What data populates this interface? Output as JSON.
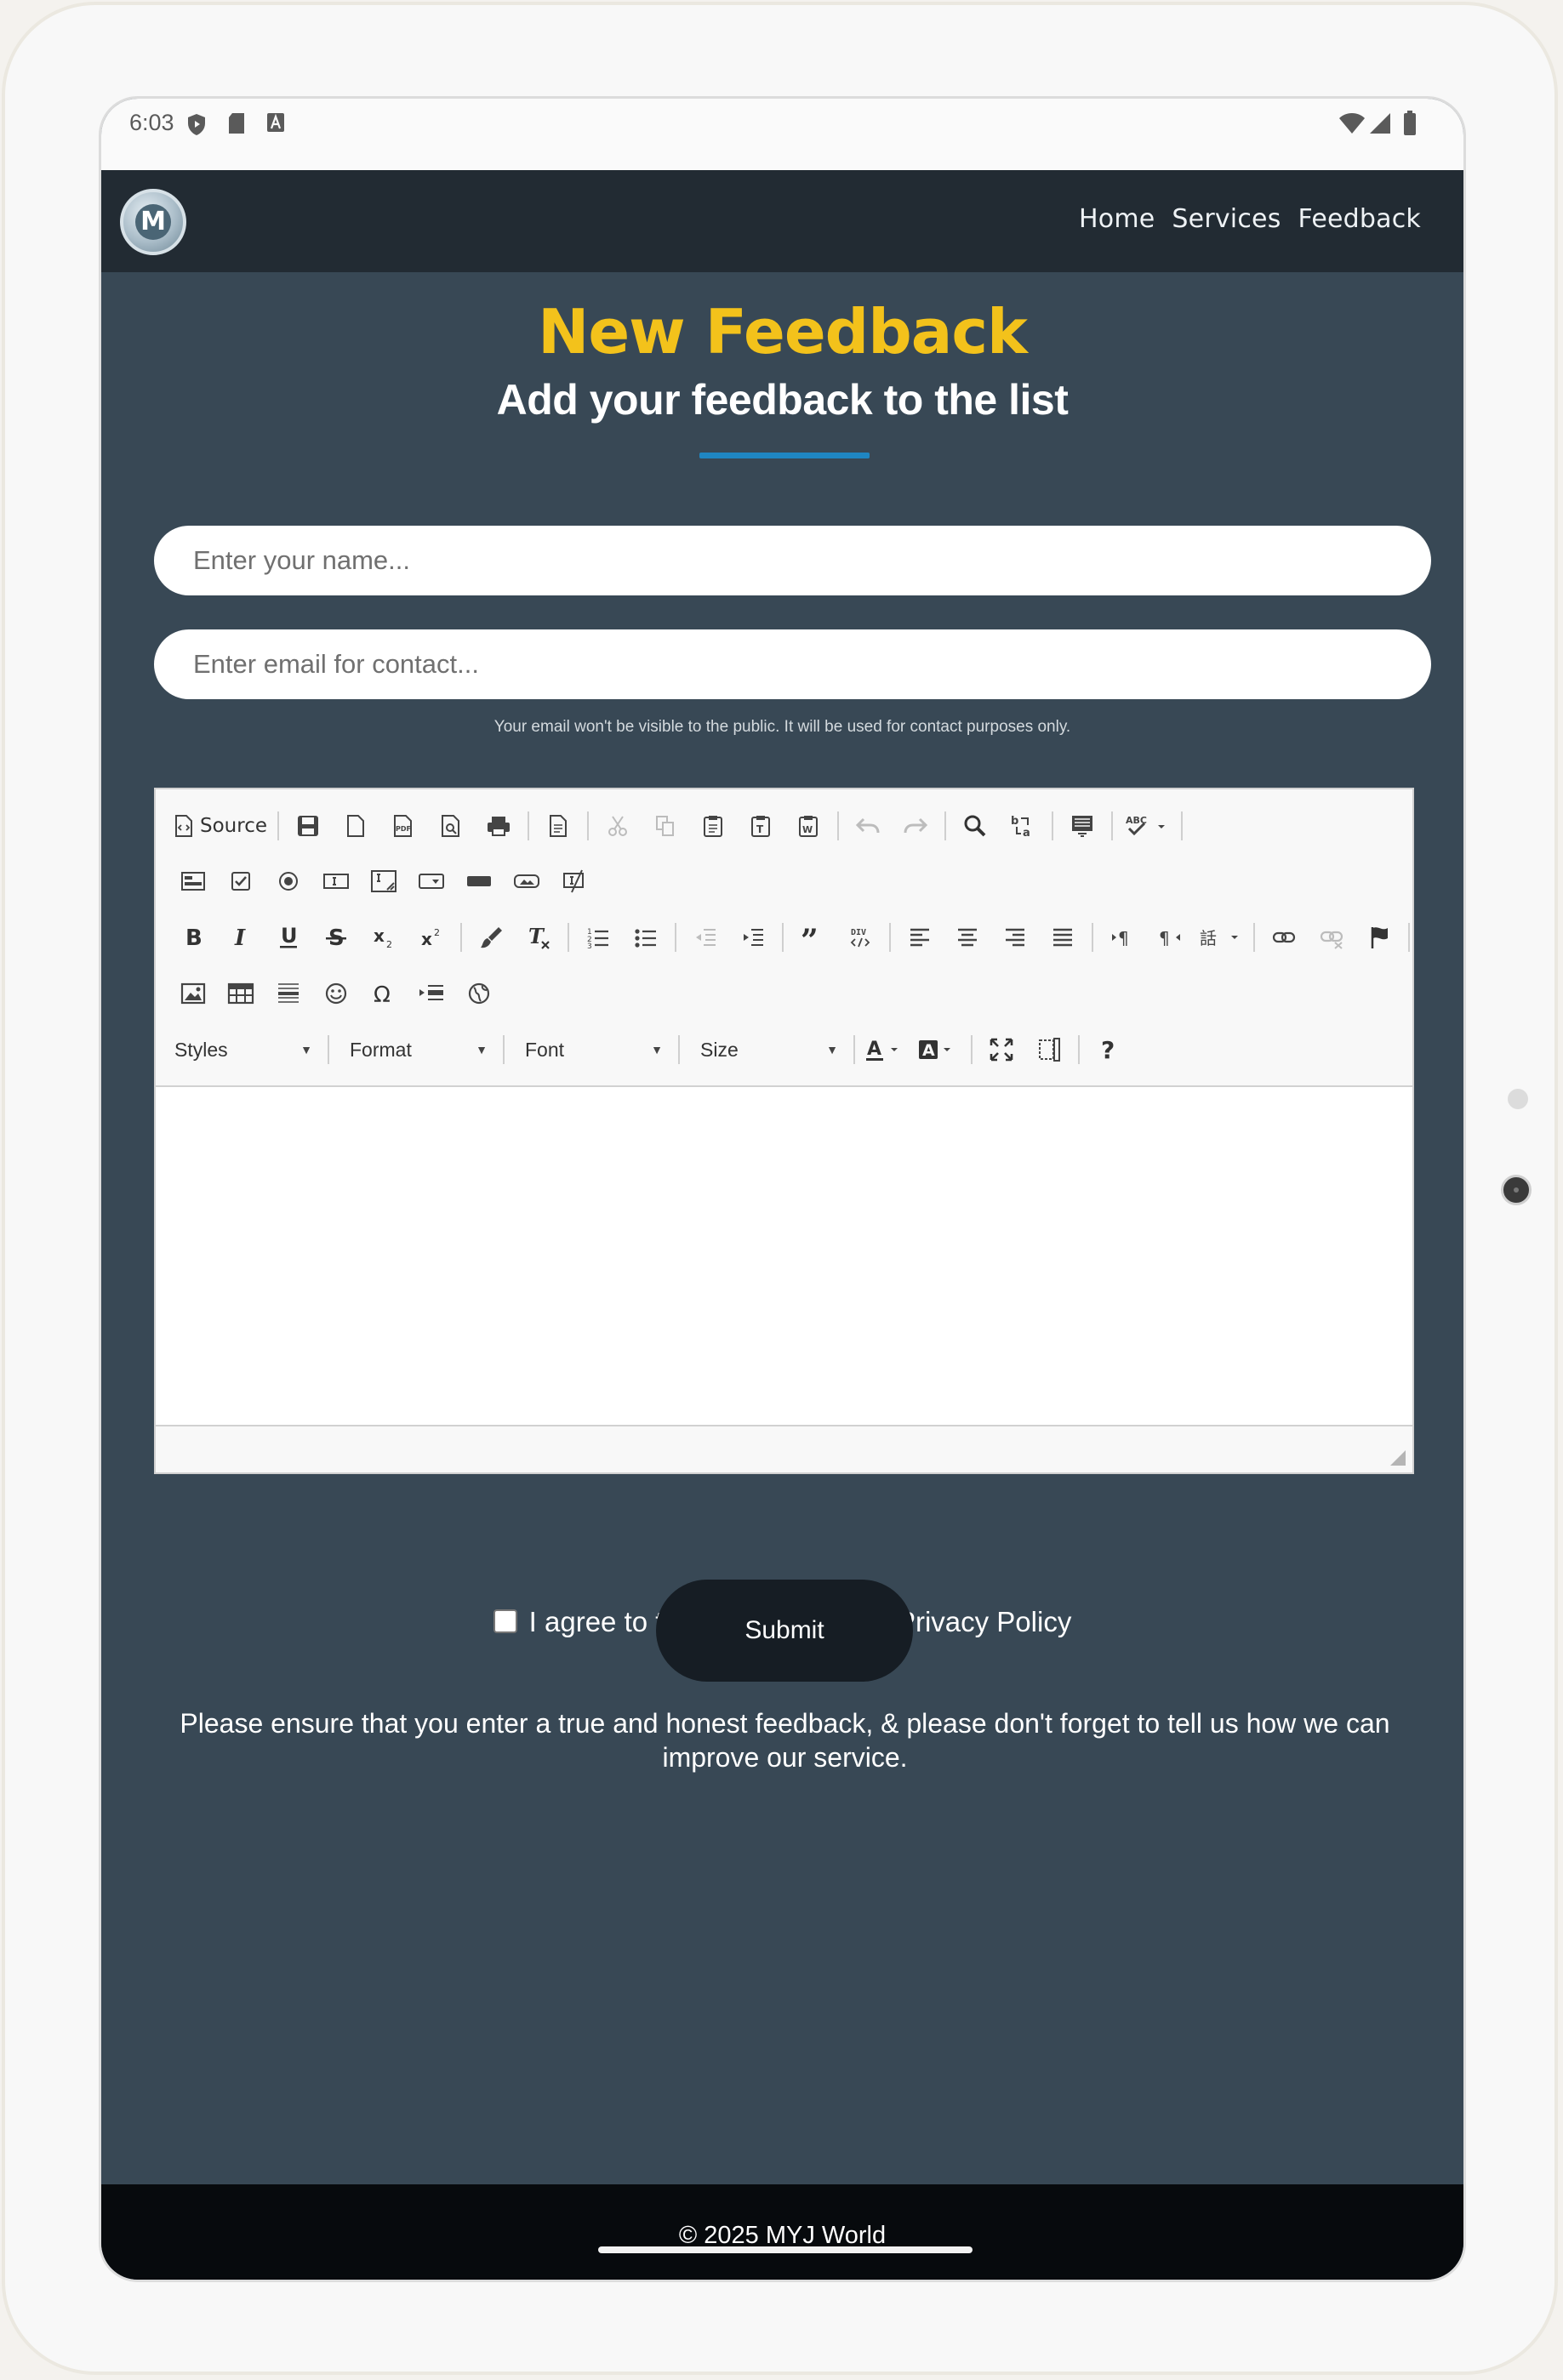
{
  "statusbar": {
    "time": "6:03",
    "icons": [
      "shield-icon",
      "sd-card-icon",
      "font-icon",
      "wifi-icon",
      "signal-icon",
      "battery-icon"
    ]
  },
  "navbar": {
    "logo_letter": "M",
    "links": [
      "Home",
      "Services",
      "Feedback"
    ]
  },
  "header": {
    "title": "New Feedback",
    "subtitle": "Add your feedback to the list"
  },
  "form": {
    "name_placeholder": "Enter your name...",
    "email_placeholder": "Enter email for contact...",
    "email_note": "Your email won't be visible to the public. It will be used for contact purposes only.",
    "agree_label": "I agree to the Terms of use & Privacy Policy",
    "submit_label": "Submit",
    "bottom_note": "Please ensure that you enter a true and honest feedback, & please don't forget to tell us how we can improve our service."
  },
  "editor": {
    "source_label": "Source",
    "combos": [
      "Styles",
      "Format",
      "Font",
      "Size"
    ]
  },
  "footer": {
    "copyright": "© 2025 MYJ World"
  },
  "colors": {
    "accent": "#f3c21b",
    "divider": "#1f86c2",
    "page_bg": "#384855",
    "nav_bg": "#222b33",
    "footer_bg": "#070a0d"
  }
}
